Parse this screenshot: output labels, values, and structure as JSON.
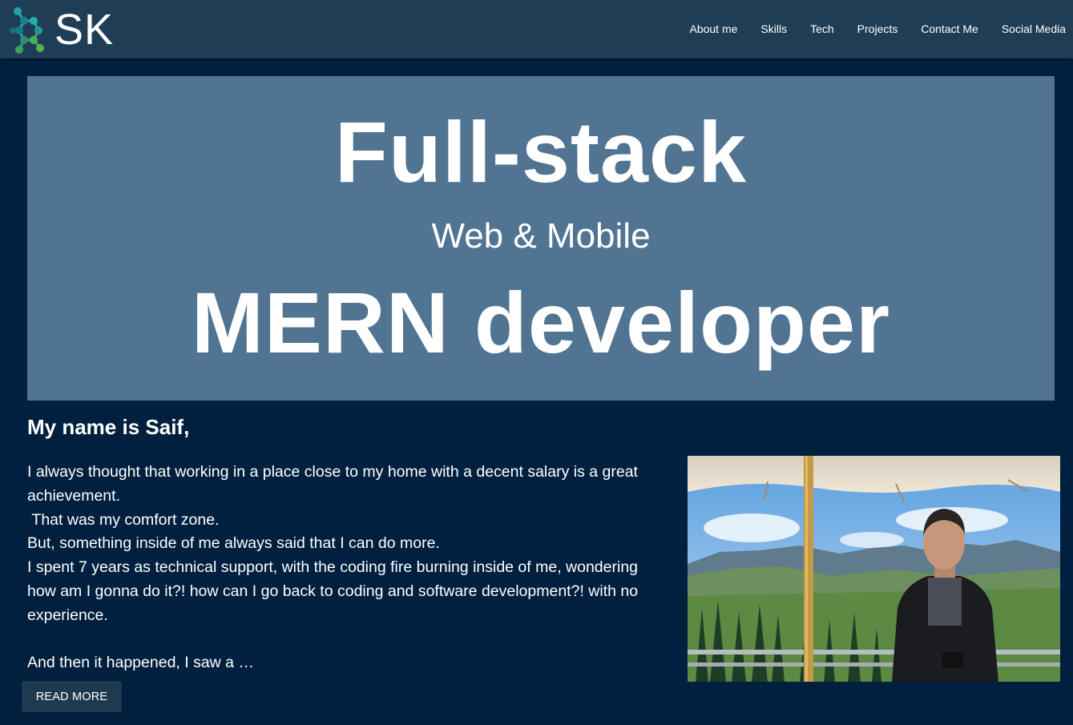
{
  "header": {
    "logo_text": "SK",
    "nav": [
      "About me",
      "Skills",
      "Tech",
      "Projects",
      "Contact Me",
      "Social Media"
    ]
  },
  "hero": {
    "title": "Full-stack",
    "subtitle": "Web & Mobile",
    "role": "MERN developer"
  },
  "about": {
    "heading": "My name is Saif,",
    "paragraphs": [
      "I always thought that working in a place close to my home with a decent salary is a great achievement.",
      " That was my comfort zone.",
      "But, something inside of me always said that I can do more.",
      "I spent 7 years as technical support, with the coding fire burning inside of me, wondering how am I gonna do it?! how can I go back to coding and software development?! with no experience.",
      "",
      "And then it happened, I saw a …"
    ],
    "read_more": "READ MORE"
  },
  "colors": {
    "page_bg": "#01203f",
    "header_bg": "#1f3e56",
    "hero_bg": "#507491",
    "button_bg": "#1e3a50"
  }
}
